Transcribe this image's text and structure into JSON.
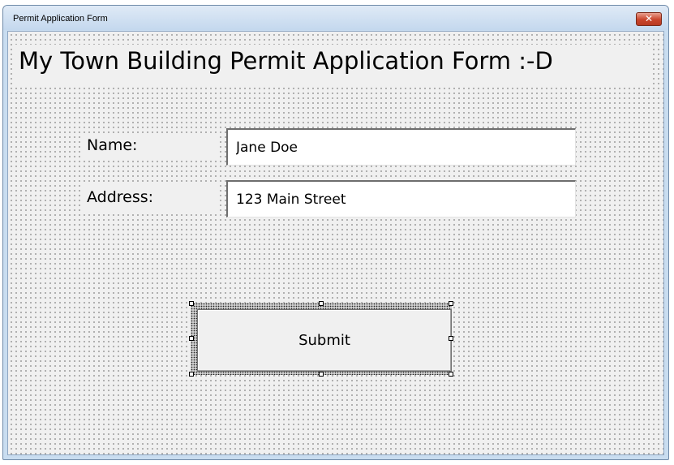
{
  "window": {
    "title": "Permit Application Form",
    "close_glyph": "✕"
  },
  "form": {
    "heading": "My Town Building Permit Application Form :-D",
    "name_label": "Name:",
    "name_value": "Jane Doe",
    "address_label": "Address:",
    "address_value": "123 Main Street",
    "submit_label": "Submit"
  },
  "colors": {
    "form_background": "#f0f0f0",
    "close_button": "#c9452c",
    "title_bar": "#c4d8ee"
  },
  "icons": {
    "close": "close-icon"
  }
}
